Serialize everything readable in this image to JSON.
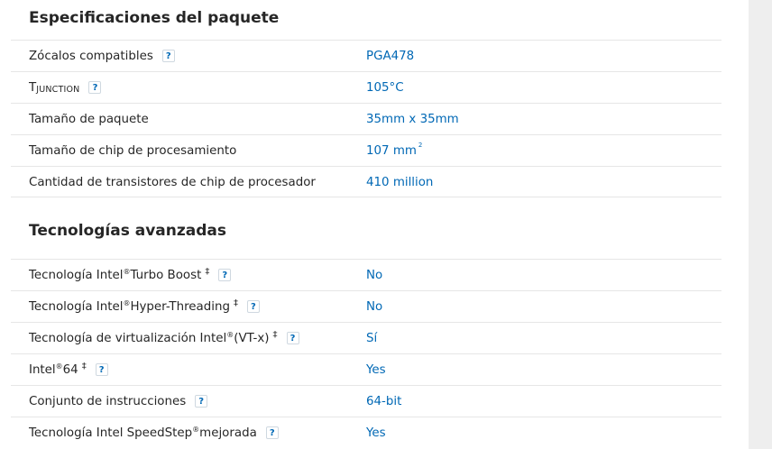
{
  "package": {
    "title": "Especificaciones del paquete",
    "rows": [
      {
        "label": "Zócalos compatibles",
        "value": "PGA478"
      },
      {
        "label_main": "T",
        "label_sub": "JUNCTION",
        "value": "105°C"
      },
      {
        "label": "Tamaño de paquete",
        "value": "35mm x 35mm"
      },
      {
        "label": "Tamaño de chip de procesamiento",
        "value": "107 mm",
        "value_sup": "2"
      },
      {
        "label": "Cantidad de transistores de chip de procesador",
        "value": "410 million"
      }
    ]
  },
  "advanced": {
    "title": "Tecnologías avanzadas",
    "rows": [
      {
        "label_pre": "Tecnología Intel",
        "reg": "®",
        "label_post": " Turbo Boost",
        "dagger": "‡",
        "value": "No"
      },
      {
        "label_pre": "Tecnología Intel",
        "reg": "®",
        "label_post": " Hyper-Threading",
        "dagger": "‡",
        "value": "No"
      },
      {
        "label_pre": "Tecnología de virtualización Intel",
        "reg": "®",
        "label_post": " (VT-x)",
        "dagger": "‡",
        "value": "Sí"
      },
      {
        "label_pre": "Intel",
        "reg": "®",
        "label_post": " 64",
        "dagger": "‡",
        "value": "Yes"
      },
      {
        "label": "Conjunto de instrucciones",
        "value": "64-bit"
      },
      {
        "label_pre": "Tecnología Intel SpeedStep",
        "reg": "®",
        "label_post": " mejorada",
        "value": "Yes"
      }
    ]
  },
  "help_glyph": "?",
  "icons": {
    "help": "question-icon"
  },
  "colors": {
    "value": "#0068b5",
    "text": "#262626",
    "divider": "#e6e6e6"
  }
}
